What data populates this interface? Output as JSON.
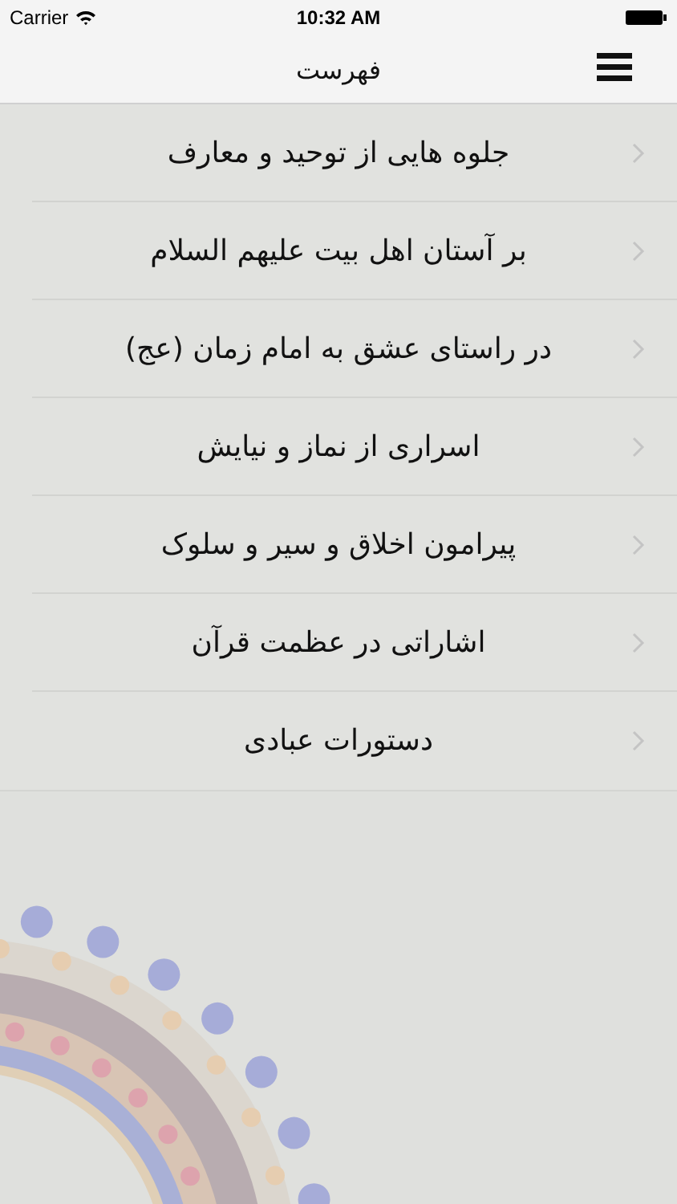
{
  "status_bar": {
    "carrier": "Carrier",
    "time": "10:32 AM"
  },
  "nav_bar": {
    "title": "فهرست"
  },
  "menu_items": [
    {
      "label": "جلوه هایی از توحید و معارف"
    },
    {
      "label": "بر آستان اهل بیت علیهم السلام"
    },
    {
      "label": "در راستای عشق به امام زمان (عج)"
    },
    {
      "label": "اسراری از نماز و نیایش"
    },
    {
      "label": "پیرامون اخلاق و سیر و سلوک"
    },
    {
      "label": "اشاراتی در عظمت قرآن"
    },
    {
      "label": "دستورات عبادی"
    }
  ]
}
